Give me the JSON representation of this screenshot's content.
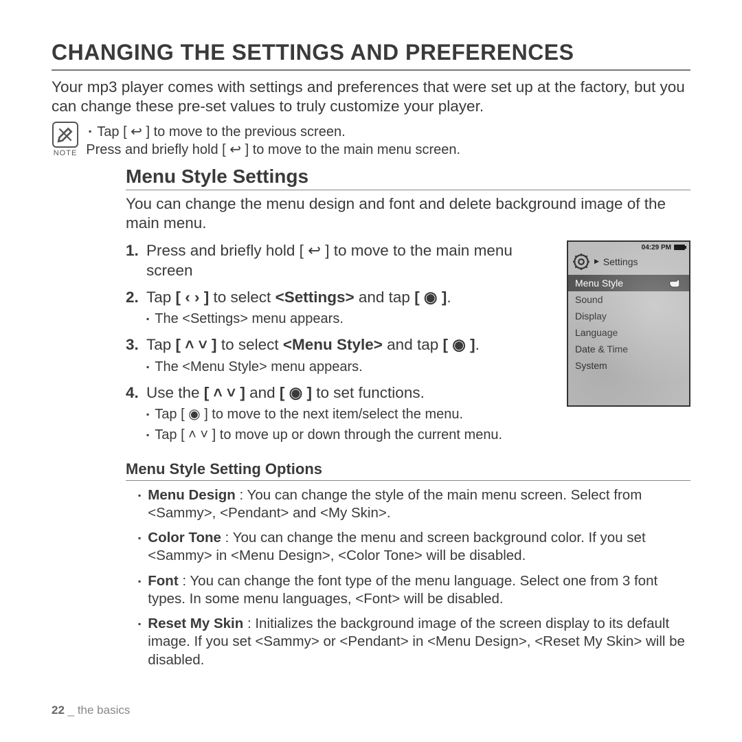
{
  "title": "CHANGING THE SETTINGS AND PREFERENCES",
  "intro": "Your mp3 player comes with settings and preferences that were set up at the factory, but you can change these pre-set values to truly customize your player.",
  "note_label": "NOTE",
  "note_lines": [
    "Tap [ ↩ ] to move to the previous screen.",
    "Press and briefly hold [ ↩ ] to move to the main menu screen."
  ],
  "section": {
    "title": "Menu Style Settings",
    "intro": "You can change the menu design and font and delete background image of the main menu."
  },
  "steps": [
    {
      "num": "1.",
      "text": "Press and briefly hold [ ↩ ] to move to the main menu screen",
      "subs": []
    },
    {
      "num": "2.",
      "html": "Tap <b>[ ‹ › ]</b> to select <b>&lt;Settings&gt;</b> and tap <b>[ ◉ ]</b>.",
      "subs": [
        "The <Settings> menu appears."
      ]
    },
    {
      "num": "3.",
      "html": "Tap <b>[ ˄ ˅ ]</b> to select <b>&lt;Menu Style&gt;</b> and tap <b>[ ◉ ]</b>.",
      "subs": [
        "The <Menu Style> menu appears."
      ]
    },
    {
      "num": "4.",
      "html": "Use the <b>[ ˄ ˅ ]</b> and <b>[ ◉ ]</b> to set functions.",
      "subs": [
        "Tap [ ◉ ] to move to the next item/select the menu.",
        "Tap [ ˄ ˅ ] to move up or down through the current menu."
      ]
    }
  ],
  "options_title": "Menu Style Setting Options",
  "options": [
    {
      "label": "Menu Design",
      "text": " : You can change the style of the main menu screen. Select from <Sammy>, <Pendant> and <My Skin>."
    },
    {
      "label": "Color Tone",
      "text": " : You can change the menu and screen background color. If you set <Sammy> in <Menu Design>, <Color Tone> will be disabled."
    },
    {
      "label": "Font",
      "text": " : You can change the font type of the menu language. Select one from 3 font types. In some menu languages, <Font> will be disabled."
    },
    {
      "label": "Reset My Skin",
      "text": " : Initializes the background image of the screen display to its default image. If you set <Sammy> or <Pendant> in <Menu Design>, <Reset My Skin> will be disabled."
    }
  ],
  "device": {
    "time": "04:29 PM",
    "header": "Settings",
    "items": [
      "Menu Style",
      "Sound",
      "Display",
      "Language",
      "Date & Time",
      "System"
    ],
    "selected": 0
  },
  "footer": {
    "page": "22",
    "sep": " _ ",
    "section": "the basics"
  }
}
